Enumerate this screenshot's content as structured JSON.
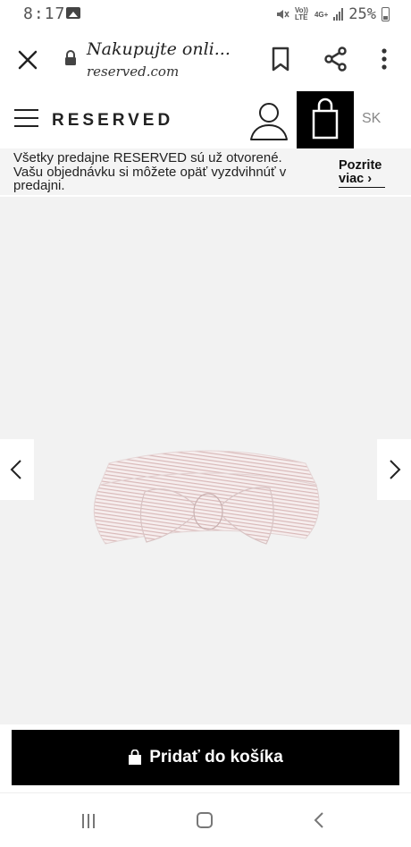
{
  "status_bar": {
    "time": "8:17",
    "network": "Vo)) LTE",
    "network_type": "4G+",
    "battery": "25%"
  },
  "browser": {
    "page_title": "Nakupujte onli...",
    "url": "reserved.com"
  },
  "header": {
    "brand": "RESERVED",
    "language": "SK"
  },
  "banner": {
    "line1": "Všetky predajne RESERVED sú už otvorené.",
    "line2": "Vašu objednávku si môžete opäť vyzdvihnúť v predajni.",
    "link_label": "Pozrite viac ›"
  },
  "product": {
    "image_icon": "striped-bow-headband"
  },
  "cta": {
    "label": "Pridať do košíka"
  },
  "colors": {
    "accent": "#000000",
    "gallery_bg": "#f2f2f2",
    "banner_bg": "#f4f4f4"
  }
}
